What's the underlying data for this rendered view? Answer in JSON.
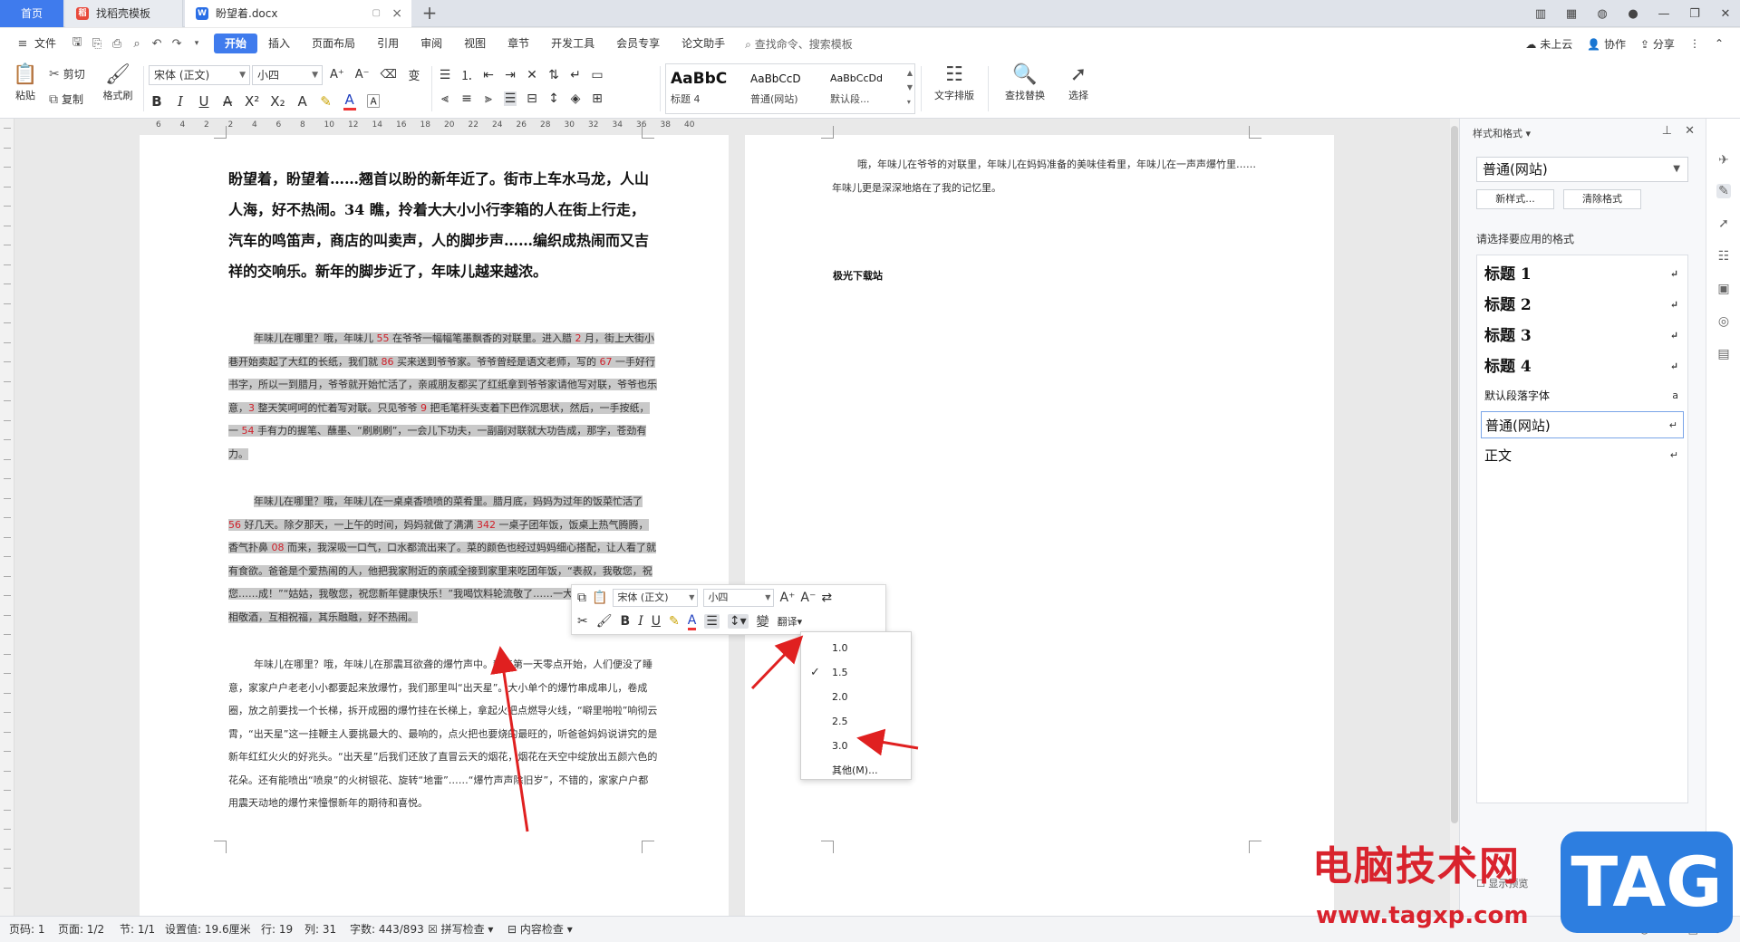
{
  "tabs": {
    "home": "首页",
    "template": "找稻壳模板",
    "doc": "盼望着.docx"
  },
  "menubar": {
    "file": "文件",
    "items": [
      "开始",
      "插入",
      "页面布局",
      "引用",
      "审阅",
      "视图",
      "章节",
      "开发工具",
      "会员专享",
      "论文助手"
    ],
    "search": "查找命令、搜索模板",
    "cloud": "未上云",
    "collab": "协作",
    "share": "分享"
  },
  "ribbon": {
    "paste": "粘贴",
    "cut": "剪切",
    "copy": "复制",
    "format_painter": "格式刷",
    "font_name": "宋体 (正文)",
    "font_size": "小四",
    "styles": [
      {
        "sample": "AaBbC",
        "name": "标题 4"
      },
      {
        "sample": "AaBbCcD",
        "name": "普通(网站)"
      },
      {
        "sample": "AaBbCcDd",
        "name": "默认段..."
      }
    ],
    "text_layout": "文字排版",
    "find_replace": "查找替换",
    "select": "选择"
  },
  "ruler": [
    "6",
    "4",
    "2",
    "2",
    "4",
    "6",
    "8",
    "10",
    "12",
    "14",
    "16",
    "18",
    "20",
    "22",
    "24",
    "26",
    "28",
    "30",
    "32",
    "34",
    "36",
    "38",
    "40"
  ],
  "document": {
    "heading": "盼望着，盼望着……翘首以盼的新年近了。街市上车水马龙，人山人海，好不热闹。34 瞧，拎着大大小小行李箱的人在街上行走，汽车的鸣笛声，商店的叫卖声，人的脚步声……编织成热闹而又吉祥的交响乐。新年的脚步近了，年味儿越来越浓。",
    "para1": [
      {
        "t": "年味儿在哪里？哦，年味儿 "
      },
      {
        "t": "55",
        "n": true
      },
      {
        "t": " 在爷爷一幅幅笔墨飘香的对联里。进入腊 "
      },
      {
        "t": "2",
        "n": true
      },
      {
        "t": " 月，街上大街小巷开始卖起了大红的长纸，我们就 "
      },
      {
        "t": "86",
        "n": true
      },
      {
        "t": " 买来送到爷爷家。爷爷曾经是语文老师，写的 "
      },
      {
        "t": "67",
        "n": true
      },
      {
        "t": " 一手好行书字，所以一到腊月，爷爷就开始忙活了，亲戚朋友都买了红纸拿到爷爷家请他写对联，爷爷也乐意，"
      },
      {
        "t": "3",
        "n": true
      },
      {
        "t": " 整天笑呵呵的忙着写对联。只见爷爷 "
      },
      {
        "t": "9",
        "n": true
      },
      {
        "t": " 把毛笔杆头支着下巴作沉思状，然后，一手按纸，一 "
      },
      {
        "t": "54",
        "n": true
      },
      {
        "t": " 手有力的握笔、蘸墨、“刷刷刷”，一会儿下功夫，一副副对联就大功告成，那字，苍劲有力。"
      }
    ],
    "para2": [
      {
        "t": "年味儿在哪里？哦，年味儿在一桌桌香喷喷的菜肴里。腊月底，妈妈为过年的饭菜忙活了 "
      },
      {
        "t": "56",
        "n": true
      },
      {
        "t": " 好几天。除夕那天，一上午的时间，妈妈就做了满满 "
      },
      {
        "t": "342",
        "n": true
      },
      {
        "t": " 一桌子团年饭，饭桌上热气腾腾，香气扑鼻 "
      },
      {
        "t": "08",
        "n": true
      },
      {
        "t": " 而来，我深吸一口气，口水都流出来了。菜的颜色也经过妈妈细心搭配，让人看了就有食欲。爸爸是个爱热闹的人，他把我家附近的亲戚全接到家里来吃团年饭，“表叔，我敬您，祝您……成！”“姑姑，我敬您，祝您新年健康快乐！”我喝饮料轮流敬了……一大家人欢聚在一起互相敬酒，互相祝福，其乐融融，好不热闹。"
      }
    ],
    "para3": "年味儿在哪里？哦，年味儿在那震耳欲聋的爆竹声中。新年第一天零点开始，人们便没了睡意，家家户户老老小小都要起来放爆竹，我们那里叫“出天星”。大小单个的爆竹串成串儿，卷成圈，放之前要找一个长梯，拆开成圈的爆竹挂在长梯上，拿起火把点燃导火线，“噼里啪啦”响彻云霄，“出天星”这一挂鞭主人要挑最大的、最响的，点火把也要烧的最旺的，听爸爸妈妈说讲究的是新年红红火火的好兆头。“出天星”后我们还放了直冒云天的烟花，烟花在天空中绽放出五颜六色的花朵。还有能喷出“喷泉”的火树银花、旋转“地雷”……“爆竹声声除旧岁”，不错的，家家户户都用震天动地的爆竹来憧憬新年的期待和喜悦。",
    "right_para": "哦，年味儿在爷爷的对联里，年味儿在妈妈准备的美味佳肴里，年味儿在一声声爆竹里…… 年味儿更是深深地烙在了我的记忆里。",
    "right_title": "极光下载站"
  },
  "minibar": {
    "font_name": "宋体 (正文)",
    "font_size": "小四",
    "translate": "翻译"
  },
  "spacing_menu": {
    "options": [
      "1.0",
      "1.5",
      "2.0",
      "2.5",
      "3.0"
    ],
    "checked": "1.5",
    "other": "其他(M)..."
  },
  "sidepane": {
    "title": "样式和格式",
    "current_style": "普通(网站)",
    "new_style": "新样式...",
    "clear_format": "清除格式",
    "select_label": "请选择要应用的格式",
    "styles": [
      "标题 1",
      "标题 2",
      "标题 3",
      "标题 4",
      "默认段落字体",
      "普通(网站)",
      "正文"
    ],
    "selected": "普通(网站)",
    "bottom": "显示预览"
  },
  "status": {
    "page_code": "页码: 1",
    "page": "页面: 1/2",
    "section": "节: 1/1",
    "setting": "设置值: 19.6厘米",
    "row": "行: 19",
    "col": "列: 31",
    "word_count": "字数: 443/893",
    "spell_check": "拼写检查",
    "content_check": "内容检查"
  },
  "watermark": {
    "site_cn": "电脑技术网",
    "site_url": "www.tagxp.com",
    "tag": "TAG"
  },
  "colors": {
    "accent": "#3f7bed",
    "highlight": "#c9c9c9",
    "number_red": "#d0202a",
    "arrow_red": "#e02020"
  }
}
